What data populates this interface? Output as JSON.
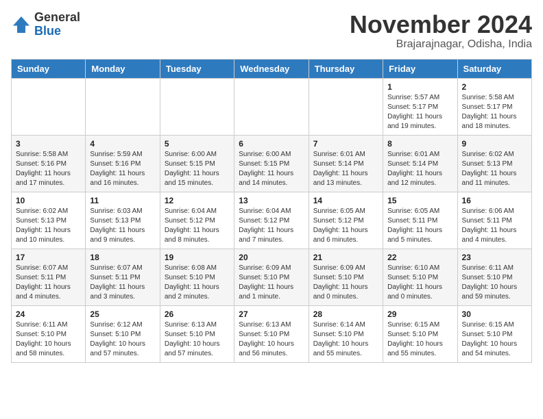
{
  "header": {
    "logo_line1": "General",
    "logo_line2": "Blue",
    "month": "November 2024",
    "location": "Brajarajnagar, Odisha, India"
  },
  "weekdays": [
    "Sunday",
    "Monday",
    "Tuesday",
    "Wednesday",
    "Thursday",
    "Friday",
    "Saturday"
  ],
  "weeks": [
    [
      {
        "day": "",
        "info": ""
      },
      {
        "day": "",
        "info": ""
      },
      {
        "day": "",
        "info": ""
      },
      {
        "day": "",
        "info": ""
      },
      {
        "day": "",
        "info": ""
      },
      {
        "day": "1",
        "info": "Sunrise: 5:57 AM\nSunset: 5:17 PM\nDaylight: 11 hours\nand 19 minutes."
      },
      {
        "day": "2",
        "info": "Sunrise: 5:58 AM\nSunset: 5:17 PM\nDaylight: 11 hours\nand 18 minutes."
      }
    ],
    [
      {
        "day": "3",
        "info": "Sunrise: 5:58 AM\nSunset: 5:16 PM\nDaylight: 11 hours\nand 17 minutes."
      },
      {
        "day": "4",
        "info": "Sunrise: 5:59 AM\nSunset: 5:16 PM\nDaylight: 11 hours\nand 16 minutes."
      },
      {
        "day": "5",
        "info": "Sunrise: 6:00 AM\nSunset: 5:15 PM\nDaylight: 11 hours\nand 15 minutes."
      },
      {
        "day": "6",
        "info": "Sunrise: 6:00 AM\nSunset: 5:15 PM\nDaylight: 11 hours\nand 14 minutes."
      },
      {
        "day": "7",
        "info": "Sunrise: 6:01 AM\nSunset: 5:14 PM\nDaylight: 11 hours\nand 13 minutes."
      },
      {
        "day": "8",
        "info": "Sunrise: 6:01 AM\nSunset: 5:14 PM\nDaylight: 11 hours\nand 12 minutes."
      },
      {
        "day": "9",
        "info": "Sunrise: 6:02 AM\nSunset: 5:13 PM\nDaylight: 11 hours\nand 11 minutes."
      }
    ],
    [
      {
        "day": "10",
        "info": "Sunrise: 6:02 AM\nSunset: 5:13 PM\nDaylight: 11 hours\nand 10 minutes."
      },
      {
        "day": "11",
        "info": "Sunrise: 6:03 AM\nSunset: 5:13 PM\nDaylight: 11 hours\nand 9 minutes."
      },
      {
        "day": "12",
        "info": "Sunrise: 6:04 AM\nSunset: 5:12 PM\nDaylight: 11 hours\nand 8 minutes."
      },
      {
        "day": "13",
        "info": "Sunrise: 6:04 AM\nSunset: 5:12 PM\nDaylight: 11 hours\nand 7 minutes."
      },
      {
        "day": "14",
        "info": "Sunrise: 6:05 AM\nSunset: 5:12 PM\nDaylight: 11 hours\nand 6 minutes."
      },
      {
        "day": "15",
        "info": "Sunrise: 6:05 AM\nSunset: 5:11 PM\nDaylight: 11 hours\nand 5 minutes."
      },
      {
        "day": "16",
        "info": "Sunrise: 6:06 AM\nSunset: 5:11 PM\nDaylight: 11 hours\nand 4 minutes."
      }
    ],
    [
      {
        "day": "17",
        "info": "Sunrise: 6:07 AM\nSunset: 5:11 PM\nDaylight: 11 hours\nand 4 minutes."
      },
      {
        "day": "18",
        "info": "Sunrise: 6:07 AM\nSunset: 5:11 PM\nDaylight: 11 hours\nand 3 minutes."
      },
      {
        "day": "19",
        "info": "Sunrise: 6:08 AM\nSunset: 5:10 PM\nDaylight: 11 hours\nand 2 minutes."
      },
      {
        "day": "20",
        "info": "Sunrise: 6:09 AM\nSunset: 5:10 PM\nDaylight: 11 hours\nand 1 minute."
      },
      {
        "day": "21",
        "info": "Sunrise: 6:09 AM\nSunset: 5:10 PM\nDaylight: 11 hours\nand 0 minutes."
      },
      {
        "day": "22",
        "info": "Sunrise: 6:10 AM\nSunset: 5:10 PM\nDaylight: 11 hours\nand 0 minutes."
      },
      {
        "day": "23",
        "info": "Sunrise: 6:11 AM\nSunset: 5:10 PM\nDaylight: 10 hours\nand 59 minutes."
      }
    ],
    [
      {
        "day": "24",
        "info": "Sunrise: 6:11 AM\nSunset: 5:10 PM\nDaylight: 10 hours\nand 58 minutes."
      },
      {
        "day": "25",
        "info": "Sunrise: 6:12 AM\nSunset: 5:10 PM\nDaylight: 10 hours\nand 57 minutes."
      },
      {
        "day": "26",
        "info": "Sunrise: 6:13 AM\nSunset: 5:10 PM\nDaylight: 10 hours\nand 57 minutes."
      },
      {
        "day": "27",
        "info": "Sunrise: 6:13 AM\nSunset: 5:10 PM\nDaylight: 10 hours\nand 56 minutes."
      },
      {
        "day": "28",
        "info": "Sunrise: 6:14 AM\nSunset: 5:10 PM\nDaylight: 10 hours\nand 55 minutes."
      },
      {
        "day": "29",
        "info": "Sunrise: 6:15 AM\nSunset: 5:10 PM\nDaylight: 10 hours\nand 55 minutes."
      },
      {
        "day": "30",
        "info": "Sunrise: 6:15 AM\nSunset: 5:10 PM\nDaylight: 10 hours\nand 54 minutes."
      }
    ]
  ]
}
